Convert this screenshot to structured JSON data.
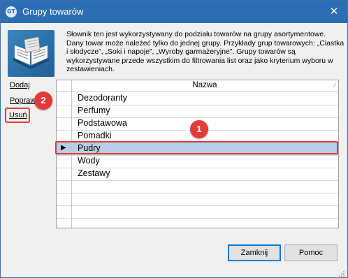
{
  "window": {
    "title": "Grupy towarów",
    "app_icon_text": "GT",
    "close_glyph": "✕"
  },
  "description": "Słownik ten jest wykorzystywany do podziału towarów na grupy asortymentowe. Dany towar może należeć tylko do jednej grupy. Przykłady grup towarowych: „Ciastka i słodycze”, „Soki i napoje”, „Wyroby garmażeryjne”. Grupy towarów są wykorzystywane przede wszystkim do filtrowania list oraz jako kryterium wyboru w zestawieniach.",
  "sidebar": {
    "add_label": "Dodaj",
    "edit_label": "Popraw",
    "delete_label": "Usuń"
  },
  "annotations": {
    "step1": "1",
    "step2": "2",
    "highlight_color": "#e53935"
  },
  "grid": {
    "column_header": "Nazwa",
    "rows": [
      "Dezodoranty",
      "Perfumy",
      "Podstawowa",
      "Pomadki",
      "Pudry",
      "Wody",
      "Zestawy"
    ],
    "selected_index": 4,
    "selected_color": "#b7cfe8"
  },
  "footer": {
    "close_label": "Zamknij",
    "help_label": "Pomoc"
  },
  "colors": {
    "titlebar": "#2d6db3",
    "dialog_bg": "#f0f0f0"
  }
}
